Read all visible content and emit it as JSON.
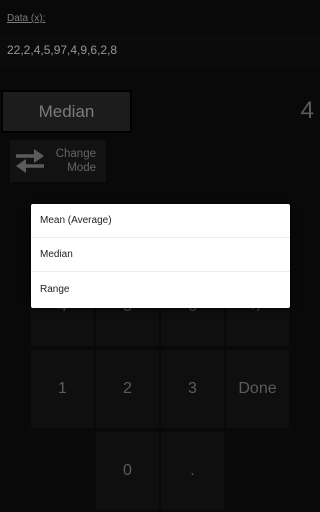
{
  "data_label": "Data (x):",
  "data_value": "22,2,4,5,97,4,9,6,2,8",
  "mode_button_label": "Median",
  "result": "4",
  "change_mode": {
    "line1": "Change",
    "line2": "Mode",
    "icon": "swap-arrows-icon"
  },
  "keys": {
    "k4": "4",
    "k5": "5",
    "k6": "6",
    "sign": "+/-",
    "k1": "1",
    "k2": "2",
    "k3": "3",
    "done": "Done",
    "k0": "0",
    "dot": "."
  },
  "menu": {
    "items": [
      "Mean (Average)",
      "Median",
      "Range"
    ]
  },
  "colors": {
    "background": "#0f0f0f",
    "key_background": "#171717",
    "menu_background": "#ffffff"
  }
}
